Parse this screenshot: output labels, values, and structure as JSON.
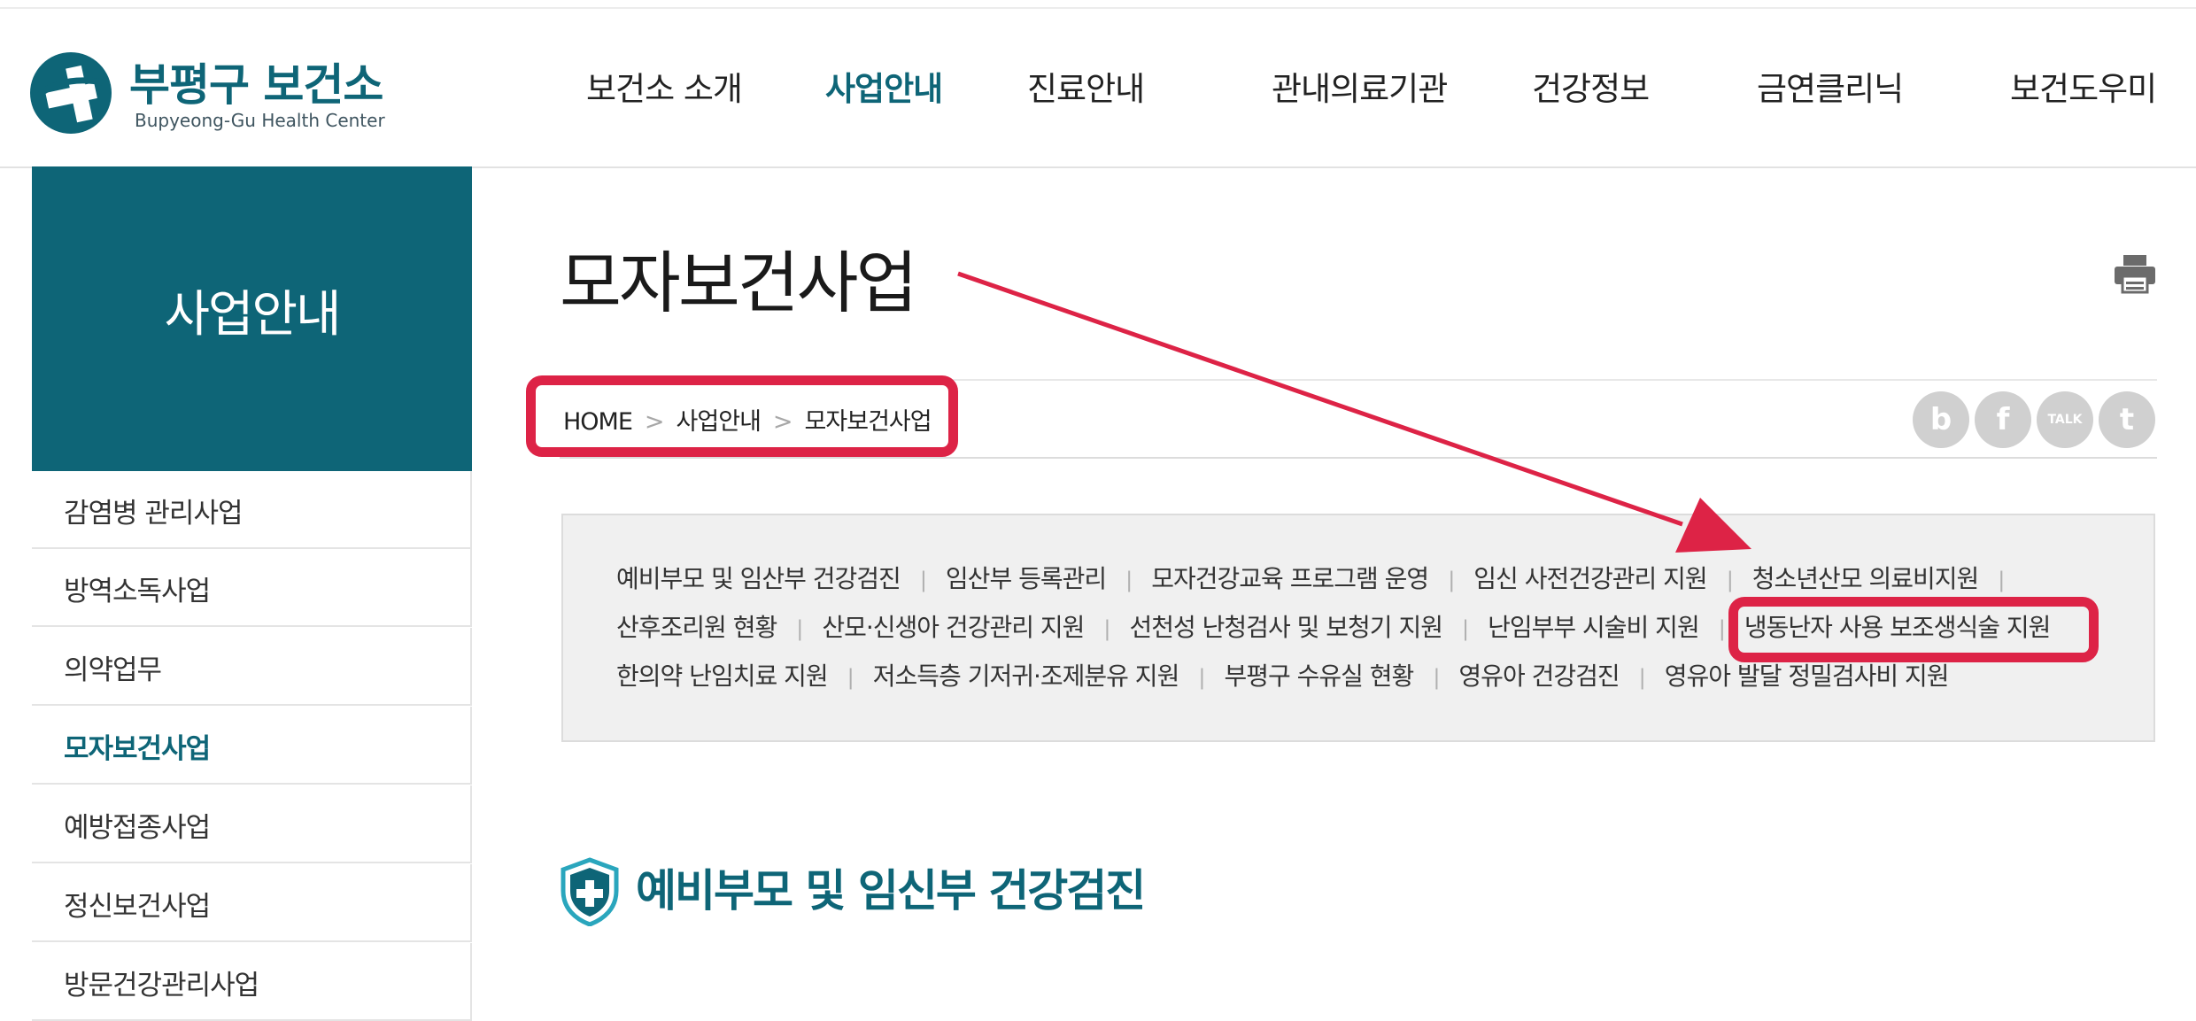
{
  "header": {
    "logo_ko": "부평구 보건소",
    "logo_en": "Bupyeong-Gu Health Center",
    "nav": [
      {
        "label": "보건소 소개",
        "active": false
      },
      {
        "label": "사업안내",
        "active": true
      },
      {
        "label": "진료안내",
        "active": false
      },
      {
        "label": "관내의료기관",
        "active": false
      },
      {
        "label": "건강정보",
        "active": false
      },
      {
        "label": "금연클리닉",
        "active": false
      },
      {
        "label": "보건도우미",
        "active": false
      }
    ]
  },
  "sidebar": {
    "title": "사업안내",
    "items": [
      {
        "label": "감염병 관리사업",
        "active": false
      },
      {
        "label": "방역소독사업",
        "active": false
      },
      {
        "label": "의약업무",
        "active": false
      },
      {
        "label": "모자보건사업",
        "active": true
      },
      {
        "label": "예방접종사업",
        "active": false
      },
      {
        "label": "정신보건사업",
        "active": false
      },
      {
        "label": "방문건강관리사업",
        "active": false
      }
    ]
  },
  "content": {
    "page_title": "모자보건사업",
    "breadcrumb": [
      "HOME",
      "사업안내",
      "모자보건사업"
    ],
    "breadcrumb_sep": ">",
    "social": [
      "b",
      "f",
      "TALK",
      "t"
    ],
    "tabs": [
      [
        "예비부모 및 임산부 건강검진",
        "임산부 등록관리",
        "모자건강교육 프로그램 운영",
        "임신 사전건강관리 지원",
        "청소년산모 의료비지원"
      ],
      [
        "산후조리원 현황",
        "산모·신생아 건강관리 지원",
        "선천성 난청검사 및 보청기 지원",
        "난임부부 시술비 지원",
        "냉동난자 사용 보조생식술 지원"
      ],
      [
        "한의약 난임치료 지원",
        "저소득층 기저귀·조제분유 지원",
        "부평구 수유실 현황",
        "영유아 건강검진",
        "영유아 발달 정밀검사비 지원"
      ]
    ],
    "tab_sep": "|",
    "section_title": "예비부모 및 임신부 건강검진"
  },
  "colors": {
    "brand": "#0e6577",
    "annotation": "#dd2346"
  }
}
